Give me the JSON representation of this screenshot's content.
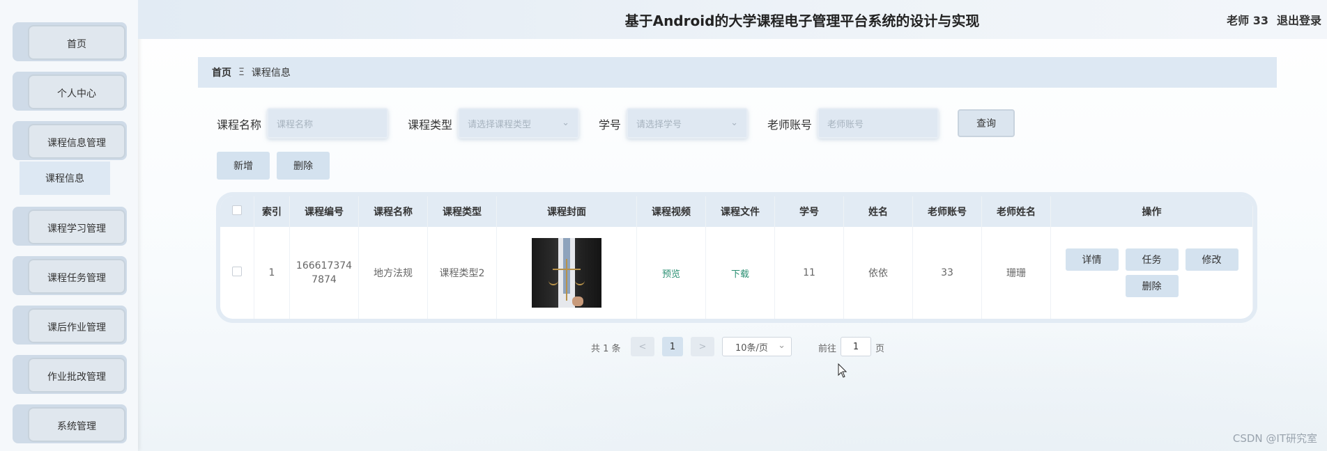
{
  "header": {
    "title": "基于Android的大学课程电子管理平台系统的设计与实现",
    "user": "老师 33",
    "logout": "退出登录"
  },
  "sidebar": {
    "items": [
      {
        "label": "首页"
      },
      {
        "label": "个人中心"
      },
      {
        "label": "课程信息管理"
      },
      {
        "label": "课程学习管理"
      },
      {
        "label": "课程任务管理"
      },
      {
        "label": "课后作业管理"
      },
      {
        "label": "作业批改管理"
      },
      {
        "label": "系统管理"
      }
    ],
    "submenu": "课程信息"
  },
  "breadcrumb": {
    "home": "首页",
    "separator": "Ξ",
    "current": "课程信息"
  },
  "search": {
    "course_name_label": "课程名称",
    "course_name_placeholder": "课程名称",
    "course_type_label": "课程类型",
    "course_type_placeholder": "请选择课程类型",
    "student_no_label": "学号",
    "student_no_placeholder": "请选择学号",
    "teacher_account_label": "老师账号",
    "teacher_account_placeholder": "老师账号",
    "query_button": "查询"
  },
  "actions": {
    "add": "新增",
    "delete": "删除"
  },
  "table": {
    "headers": [
      "索引",
      "课程编号",
      "课程名称",
      "课程类型",
      "课程封面",
      "课程视频",
      "课程文件",
      "学号",
      "姓名",
      "老师账号",
      "老师姓名",
      "操作"
    ],
    "rows": [
      {
        "index": "1",
        "course_no_line1": "166617374",
        "course_no_line2": "7874",
        "course_name": "地方法规",
        "course_type": "课程类型2",
        "video": "预览",
        "file": "下载",
        "student_no": "11",
        "name": "依依",
        "teacher_account": "33",
        "teacher_name": "珊珊",
        "ops": {
          "detail": "详情",
          "task": "任务",
          "edit": "修改",
          "delete": "删除"
        }
      }
    ]
  },
  "pagination": {
    "total": "共 1 条",
    "prev": "<",
    "current": "1",
    "next": ">",
    "page_size": "10条/页",
    "goto_label": "前往",
    "goto_value": "1",
    "page_suffix": "页"
  },
  "watermark": "CSDN @IT研究室"
}
